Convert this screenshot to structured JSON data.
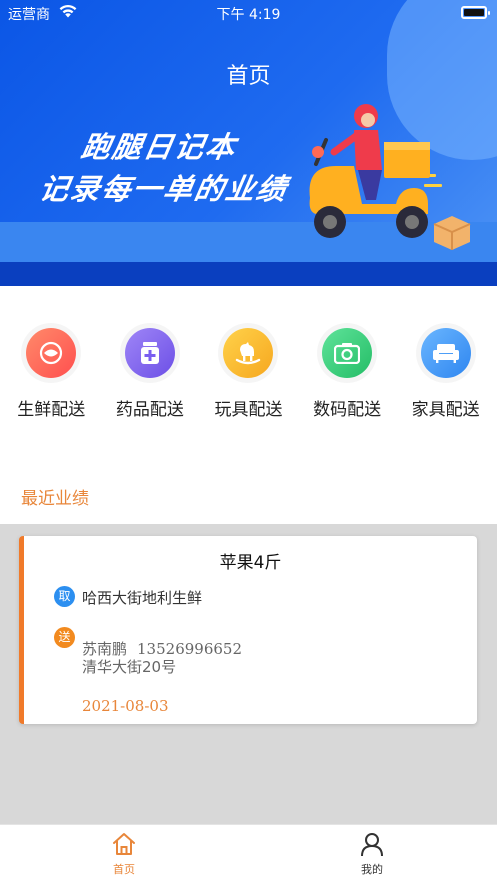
{
  "status_bar": {
    "carrier": "运营商",
    "time": "下午 4:19"
  },
  "header": {
    "title": "首页",
    "slogan_line1": "跑腿日记本",
    "slogan_line2": "记录每一单的业绩"
  },
  "categories": [
    {
      "label": "生鲜配送",
      "icon": "fresh-food-icon",
      "color": "#ff6a55"
    },
    {
      "label": "药品配送",
      "icon": "medicine-icon",
      "color": "#8a6cf0"
    },
    {
      "label": "玩具配送",
      "icon": "toy-horse-icon",
      "color": "#f9b930"
    },
    {
      "label": "数码配送",
      "icon": "camera-icon",
      "color": "#3fcf7d"
    },
    {
      "label": "家具配送",
      "icon": "sofa-icon",
      "color": "#3c9af5"
    }
  ],
  "recent": {
    "section_title": "最近业绩",
    "orders": [
      {
        "title": "苹果4斤",
        "pickup_badge": "取",
        "pickup_address": "哈西大街地利生鲜",
        "deliver_badge": "送",
        "receiver_name": "苏南鹏",
        "receiver_phone": "13526996652",
        "receiver_address": "清华大街20号",
        "date": "2021-08-03"
      }
    ]
  },
  "tabbar": {
    "home_label": "首页",
    "mine_label": "我的"
  },
  "colors": {
    "accent": "#e8863a",
    "banner_blue": "#0b56e6",
    "card_border": "#f07a2a"
  }
}
